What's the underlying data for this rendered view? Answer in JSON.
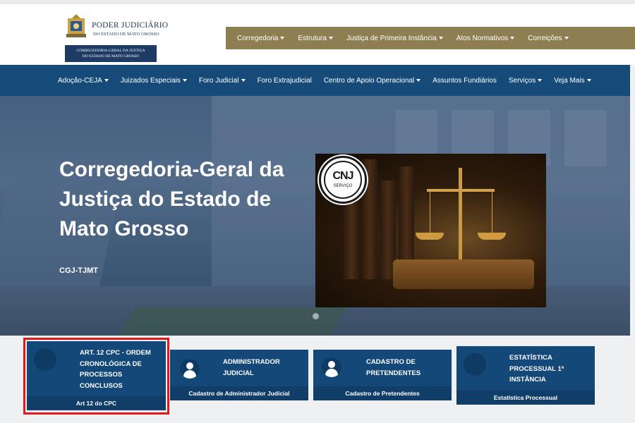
{
  "header": {
    "logo_title": "PODER JUDICIÁRIO",
    "logo_subtitle": "DO ESTADO DE MATO GROSSO",
    "logo_band_line1": "CORREGEDORIA-GERAL DA JUSTIÇA",
    "logo_band_line2": "DO ESTADO DE MATO GROSSO"
  },
  "top_nav": [
    {
      "label": "Corregedoria",
      "dropdown": true
    },
    {
      "label": "Estrutura",
      "dropdown": true
    },
    {
      "label": "Justiça de Primeira Instância",
      "dropdown": true
    },
    {
      "label": "Atos Normativos",
      "dropdown": true
    },
    {
      "label": "Correições",
      "dropdown": true
    }
  ],
  "main_nav": [
    {
      "label": "Adoção-CEJA",
      "dropdown": true
    },
    {
      "label": "Juizados Especiais",
      "dropdown": true
    },
    {
      "label": "Foro Judicial",
      "dropdown": true
    },
    {
      "label": "Foro Extrajudicial",
      "dropdown": false
    },
    {
      "label": "Centro de Apoio Operacional",
      "dropdown": true
    },
    {
      "label": "Assuntos Fundiários",
      "dropdown": false
    },
    {
      "label": "Serviços",
      "dropdown": true
    },
    {
      "label": "Veja Mais",
      "dropdown": true
    }
  ],
  "hero": {
    "title": "Corregedoria-Geral da Justiça do Estado de Mato Grosso",
    "subtitle": "CGJ-TJMT",
    "badge_title": "CNJ",
    "badge_sub": "SERVIÇO"
  },
  "cards": [
    {
      "title": "ART. 12 CPC - ORDEM CRONOLÓGICA DE PROCESSOS CONCLUSOS",
      "footer": "Art 12 do CPC",
      "icon": "circle-icon"
    },
    {
      "title": "ADMINISTRADOR JUDICIAL",
      "footer": "Cadastro de Administrador Judicial",
      "icon": "person-icon"
    },
    {
      "title": "CADASTRO DE PRETENDENTES",
      "footer": "Cadastro de Pretendentes",
      "icon": "person-icon"
    },
    {
      "title": "ESTATÍSTICA PROCESSUAL 1ª INSTÂNCIA",
      "footer": "Estatística Processual",
      "icon": "circle-icon"
    }
  ],
  "colors": {
    "gold_nav": "#8e7f52",
    "blue_nav": "#164b79",
    "card": "#144878",
    "highlight": "#e2191c"
  }
}
